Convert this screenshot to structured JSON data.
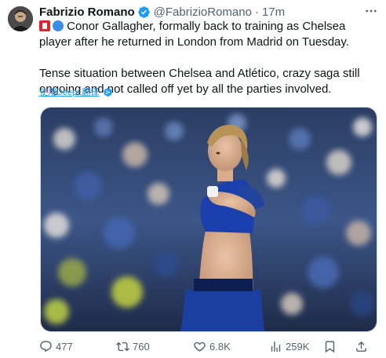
{
  "author": {
    "display_name": "Fabrizio Romano",
    "handle": "@FabrizioRomano",
    "separator": "·",
    "time": "17m"
  },
  "tweet": {
    "paragraph1": "Conor Gallagher, formally back to training as Chelsea player after he returned in London from Madrid on Tuesday.",
    "paragraph2": "Tense situation between Chelsea and Atlético, crazy saga still ongoing and not called off yet by all the parties involved.",
    "emojis": [
      "red-badge-emoji",
      "blue-circle-emoji"
    ]
  },
  "translate": {
    "label": "使用DeepL翻译"
  },
  "media": {
    "description_icon": "photo"
  },
  "actions": {
    "reply_count": "477",
    "retweet_count": "760",
    "like_count": "6.8K",
    "views_count": "259K"
  },
  "colors": {
    "accent": "#1d9bf0",
    "text": "#0f1419",
    "secondary": "#536471",
    "chelsea_blue": "#1a3fa0"
  }
}
